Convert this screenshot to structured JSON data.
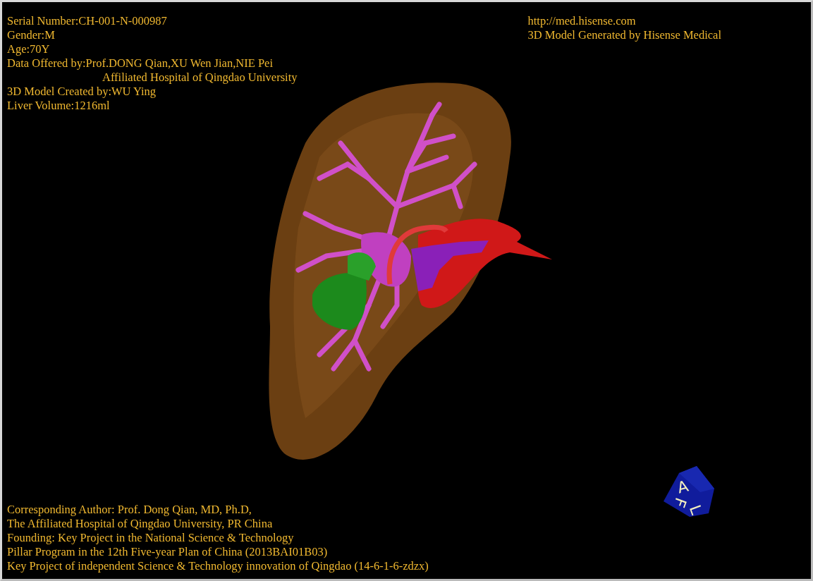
{
  "info_lines": [
    {
      "kind": "line",
      "text": "Serial Number:CH-001-N-000987"
    },
    {
      "kind": "line",
      "text": "Gender:M"
    },
    {
      "kind": "line",
      "text": "Age:70Y"
    },
    {
      "kind": "line",
      "text": "Data Offered by:Prof.DONG Qian,XU Wen Jian,NIE Pei"
    },
    {
      "kind": "continuation",
      "text": "Affiliated Hospital of Qingdao University"
    },
    {
      "kind": "line",
      "text": "3D Model Created by:WU Ying"
    },
    {
      "kind": "line",
      "text": "Liver Volume:1216ml"
    }
  ],
  "link": "http://med.hisense.com",
  "generator": "3D Model Generated by Hisense Medical",
  "credits": [
    "Corresponding Author: Prof. Dong Qian, MD, Ph.D,",
    "The Affiliated Hospital of Qingdao University, PR China",
    "Founding: Key Project in the National Science & Technology",
    "Pillar Program in the 12th Five-year Plan of China (2013BAI01B03)",
    "Key Project of independent Science & Technology innovation of Qingdao (14-6-1-6-zdzx)"
  ],
  "orientation_cube": {
    "labels": [
      "A",
      "L",
      "F"
    ]
  }
}
